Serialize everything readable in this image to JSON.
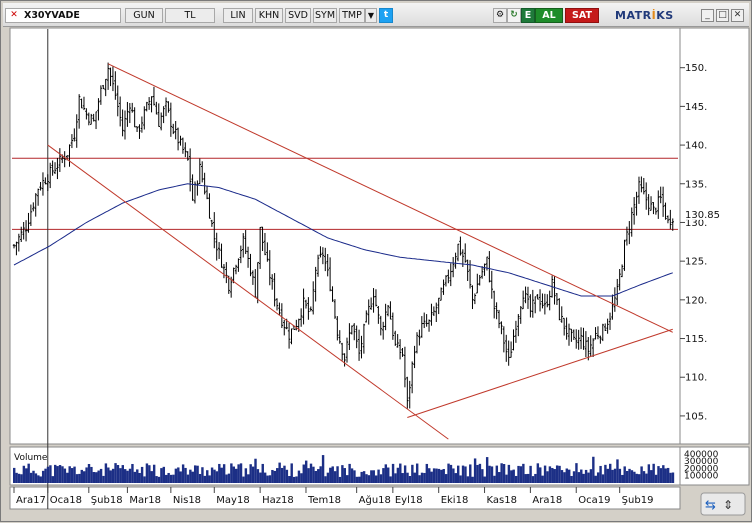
{
  "toolbar": {
    "symbol": "X30YVADE",
    "period": "GUN",
    "currency": "TL",
    "scale": "LIN",
    "khn": "KHN",
    "svd": "SVD",
    "sym": "SYM",
    "tmp": "TMP",
    "excel_label": "E",
    "buy_label": "AL",
    "sell_label": "SAT",
    "brand_pre": "MATR",
    "brand_dot": "İ",
    "brand_post": "KS"
  },
  "chart_data": {
    "type": "candlestick",
    "title": "",
    "ylim": [
      101.5,
      155
    ],
    "yticks": [
      105,
      110,
      115,
      120,
      125,
      130,
      135,
      140,
      145,
      150
    ],
    "ytick_labels": [
      "105.",
      "110.",
      "115.",
      "120.",
      "125.",
      "130.",
      "135.",
      "140.",
      "145.",
      "150."
    ],
    "last_price": 130.85,
    "last_price_label": "130.85",
    "x_labels": [
      "Ara17",
      "Oca18",
      "Şub18",
      "Mar18",
      "Nis18",
      "May18",
      "Haz18",
      "Tem18",
      "Ağu18",
      "Eyl18",
      "Eki18",
      "Kas18",
      "Ara18",
      "Oca19",
      "Şub19"
    ],
    "x_label_index": [
      0,
      14,
      31,
      47,
      65,
      83,
      102,
      121,
      142,
      157,
      176,
      195,
      214,
      233,
      251
    ],
    "num_bars": 260,
    "close_series": [
      {
        "i": 0,
        "v": 127.0
      },
      {
        "i": 5,
        "v": 129.5
      },
      {
        "i": 10,
        "v": 134.5
      },
      {
        "i": 14,
        "v": 136.0
      },
      {
        "i": 18,
        "v": 137.5
      },
      {
        "i": 22,
        "v": 139.0
      },
      {
        "i": 25,
        "v": 141.5
      },
      {
        "i": 27,
        "v": 146.0
      },
      {
        "i": 30,
        "v": 144.0
      },
      {
        "i": 33,
        "v": 143.0
      },
      {
        "i": 36,
        "v": 147.0
      },
      {
        "i": 39,
        "v": 150.0
      },
      {
        "i": 42,
        "v": 146.5
      },
      {
        "i": 45,
        "v": 142.0
      },
      {
        "i": 48,
        "v": 145.5
      },
      {
        "i": 51,
        "v": 141.5
      },
      {
        "i": 54,
        "v": 144.0
      },
      {
        "i": 57,
        "v": 146.5
      },
      {
        "i": 60,
        "v": 143.0
      },
      {
        "i": 63,
        "v": 145.0
      },
      {
        "i": 66,
        "v": 142.0
      },
      {
        "i": 69,
        "v": 140.0
      },
      {
        "i": 72,
        "v": 138.0
      },
      {
        "i": 74,
        "v": 133.0
      },
      {
        "i": 77,
        "v": 137.0
      },
      {
        "i": 80,
        "v": 133.0
      },
      {
        "i": 83,
        "v": 128.0
      },
      {
        "i": 86,
        "v": 125.0
      },
      {
        "i": 89,
        "v": 122.0
      },
      {
        "i": 92,
        "v": 125.0
      },
      {
        "i": 95,
        "v": 127.5
      },
      {
        "i": 98,
        "v": 124.0
      },
      {
        "i": 100,
        "v": 121.0
      },
      {
        "i": 102,
        "v": 129.0
      },
      {
        "i": 105,
        "v": 124.5
      },
      {
        "i": 108,
        "v": 120.5
      },
      {
        "i": 111,
        "v": 117.5
      },
      {
        "i": 114,
        "v": 115.5
      },
      {
        "i": 117,
        "v": 117.0
      },
      {
        "i": 120,
        "v": 119.5
      },
      {
        "i": 123,
        "v": 118.0
      },
      {
        "i": 125,
        "v": 124.0
      },
      {
        "i": 128,
        "v": 126.0
      },
      {
        "i": 131,
        "v": 122.0
      },
      {
        "i": 134,
        "v": 116.0
      },
      {
        "i": 137,
        "v": 112.5
      },
      {
        "i": 140,
        "v": 117.0
      },
      {
        "i": 143,
        "v": 113.0
      },
      {
        "i": 146,
        "v": 117.5
      },
      {
        "i": 149,
        "v": 121.0
      },
      {
        "i": 152,
        "v": 116.0
      },
      {
        "i": 155,
        "v": 119.5
      },
      {
        "i": 158,
        "v": 114.0
      },
      {
        "i": 161,
        "v": 113.0
      },
      {
        "i": 163,
        "v": 106.5
      },
      {
        "i": 166,
        "v": 114.0
      },
      {
        "i": 169,
        "v": 116.5
      },
      {
        "i": 172,
        "v": 117.0
      },
      {
        "i": 175,
        "v": 119.0
      },
      {
        "i": 178,
        "v": 121.5
      },
      {
        "i": 181,
        "v": 124.0
      },
      {
        "i": 184,
        "v": 127.0
      },
      {
        "i": 187,
        "v": 125.0
      },
      {
        "i": 190,
        "v": 120.0
      },
      {
        "i": 193,
        "v": 123.0
      },
      {
        "i": 196,
        "v": 125.0
      },
      {
        "i": 199,
        "v": 119.0
      },
      {
        "i": 202,
        "v": 116.0
      },
      {
        "i": 205,
        "v": 112.0
      },
      {
        "i": 208,
        "v": 117.0
      },
      {
        "i": 211,
        "v": 121.0
      },
      {
        "i": 214,
        "v": 118.5
      },
      {
        "i": 217,
        "v": 120.5
      },
      {
        "i": 220,
        "v": 119.0
      },
      {
        "i": 223,
        "v": 122.0
      },
      {
        "i": 226,
        "v": 118.0
      },
      {
        "i": 229,
        "v": 116.0
      },
      {
        "i": 232,
        "v": 114.5
      },
      {
        "i": 235,
        "v": 115.0
      },
      {
        "i": 238,
        "v": 113.5
      },
      {
        "i": 241,
        "v": 115.5
      },
      {
        "i": 244,
        "v": 116.0
      },
      {
        "i": 247,
        "v": 118.0
      },
      {
        "i": 250,
        "v": 121.0
      },
      {
        "i": 253,
        "v": 127.0
      },
      {
        "i": 256,
        "v": 131.0
      },
      {
        "i": 259,
        "v": 134.5
      },
      {
        "i": 262,
        "v": 133.0
      },
      {
        "i": 265,
        "v": 131.5
      },
      {
        "i": 268,
        "v": 133.0
      },
      {
        "i": 271,
        "v": 130.0
      },
      {
        "i": 273,
        "v": 130.85
      }
    ],
    "moving_average": [
      {
        "i": 0,
        "v": 124.5
      },
      {
        "i": 15,
        "v": 127.0
      },
      {
        "i": 30,
        "v": 130.0
      },
      {
        "i": 45,
        "v": 132.5
      },
      {
        "i": 60,
        "v": 134.2
      },
      {
        "i": 72,
        "v": 135.0
      },
      {
        "i": 85,
        "v": 134.5
      },
      {
        "i": 100,
        "v": 133.0
      },
      {
        "i": 115,
        "v": 130.5
      },
      {
        "i": 130,
        "v": 128.0
      },
      {
        "i": 145,
        "v": 126.5
      },
      {
        "i": 160,
        "v": 125.5
      },
      {
        "i": 175,
        "v": 125.0
      },
      {
        "i": 190,
        "v": 124.5
      },
      {
        "i": 205,
        "v": 123.5
      },
      {
        "i": 220,
        "v": 122.0
      },
      {
        "i": 235,
        "v": 120.5
      },
      {
        "i": 248,
        "v": 120.5
      },
      {
        "i": 260,
        "v": 122.0
      },
      {
        "i": 273,
        "v": 123.5
      }
    ],
    "horizontal_lines": [
      138.3,
      129.1
    ],
    "trend_lines": [
      {
        "name": "upper-channel",
        "from": {
          "i": 39,
          "v": 150.5
        },
        "to": {
          "i": 273,
          "v": 115.8
        }
      },
      {
        "name": "lower-channel",
        "from": {
          "i": 14,
          "v": 140.0
        },
        "to": {
          "i": 180,
          "v": 102.0
        }
      },
      {
        "name": "support-rising",
        "from": {
          "i": 163,
          "v": 104.8
        },
        "to": {
          "i": 273,
          "v": 116.2
        }
      }
    ],
    "cursor_index": 14,
    "volume_label": "Volume",
    "volume_tick_labels": [
      "400000",
      "300000",
      "200000",
      "100000"
    ]
  }
}
